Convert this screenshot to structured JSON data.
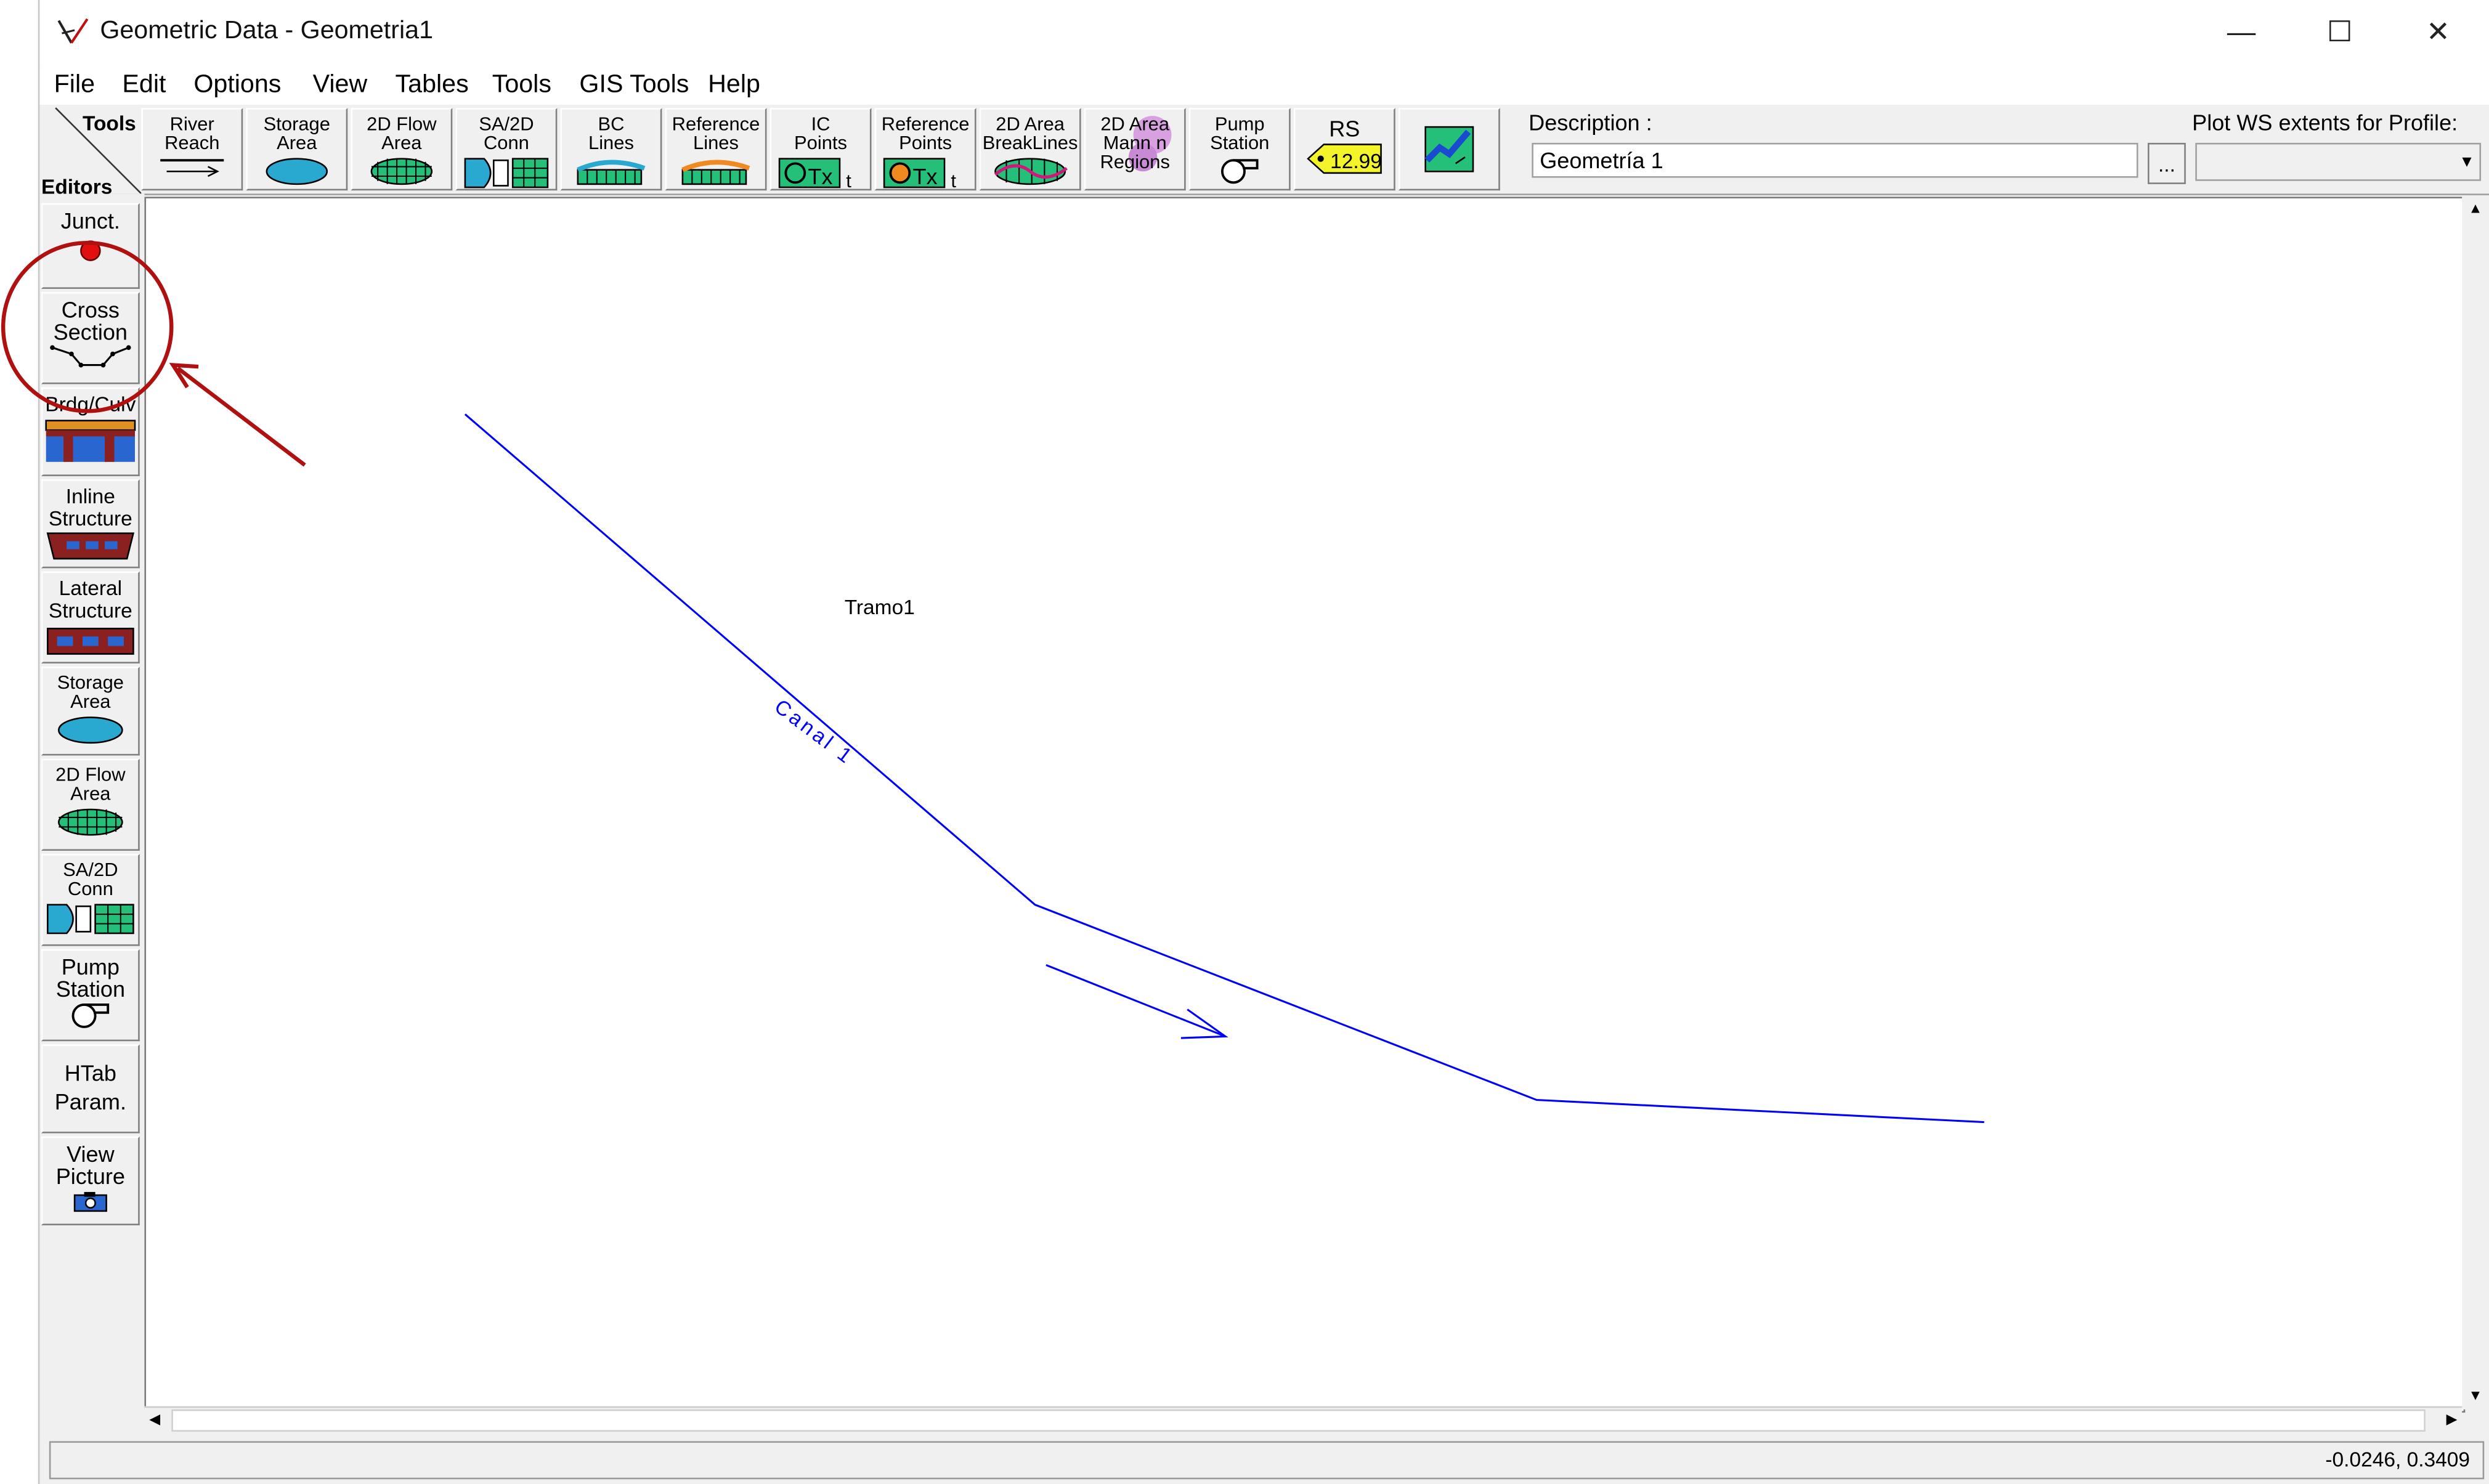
{
  "window": {
    "title": "Geometric Data - Geometria1",
    "controls": {
      "minimize": "—",
      "maximize": "☐",
      "close": "✕"
    }
  },
  "menu": [
    {
      "label": "File"
    },
    {
      "label": "Edit"
    },
    {
      "label": "Options"
    },
    {
      "label": "View"
    },
    {
      "label": "Tables"
    },
    {
      "label": "Tools"
    },
    {
      "label": "GIS Tools"
    },
    {
      "label": "Help"
    }
  ],
  "toolbar": {
    "tools_label": "Tools",
    "editors_label": "Editors",
    "buttons": [
      {
        "label": "River\nReach",
        "icon": "river-reach-icon"
      },
      {
        "label": "Storage\nArea",
        "icon": "storage-area-icon"
      },
      {
        "label": "2D Flow\nArea",
        "icon": "2d-flow-area-icon"
      },
      {
        "label": "SA/2D\nConn",
        "icon": "sa-2d-conn-icon"
      },
      {
        "label": "BC\nLines",
        "icon": "bc-lines-icon"
      },
      {
        "label": "Reference\nLines",
        "icon": "reference-lines-icon"
      },
      {
        "label": "IC\nPoints",
        "icon": "ic-points-icon"
      },
      {
        "label": "Reference\nPoints",
        "icon": "reference-points-icon"
      },
      {
        "label": "2D Area\nBreakLines",
        "icon": "breaklines-icon"
      },
      {
        "label": "2D Area\nMann n\nRegions",
        "icon": "mann-n-regions-icon"
      },
      {
        "label": "Pump\nStation",
        "icon": "pump-station-icon"
      },
      {
        "label": "RS",
        "icon": "rs-tag-icon",
        "tag": "12.99"
      },
      {
        "label": "",
        "icon": "map-icon"
      }
    ],
    "description_label": "Description :",
    "description_value": "Geometría 1",
    "description_button": "...",
    "plot_ws_label": "Plot WS extents for Profile:",
    "plot_ws_value": ""
  },
  "editors": [
    {
      "label": "Junct.",
      "icon": "junction-icon"
    },
    {
      "label": "Cross\nSection",
      "icon": "cross-section-icon"
    },
    {
      "label": "Brdg/Culv",
      "icon": "bridge-culvert-icon"
    },
    {
      "label": "Inline\nStructure",
      "icon": "inline-structure-icon"
    },
    {
      "label": "Lateral\nStructure",
      "icon": "lateral-structure-icon"
    },
    {
      "label": "Storage\nArea",
      "icon": "storage-area-icon"
    },
    {
      "label": "2D Flow\nArea",
      "icon": "2d-flow-area-icon"
    },
    {
      "label": "SA/2D\nConn",
      "icon": "sa-2d-conn-icon"
    },
    {
      "label": "Pump\nStation",
      "icon": "pump-station-icon"
    },
    {
      "label": "HTab\nParam.",
      "icon": ""
    },
    {
      "label": "View\nPicture",
      "icon": "camera-icon"
    }
  ],
  "canvas": {
    "reach_label": "Tramo1",
    "river_label": "Canal 1",
    "line_color": "#0000ff"
  },
  "status": {
    "coords": "-0.0246, 0.3409"
  },
  "annotation": {
    "color": "#b01010",
    "target": "Cross Section"
  }
}
